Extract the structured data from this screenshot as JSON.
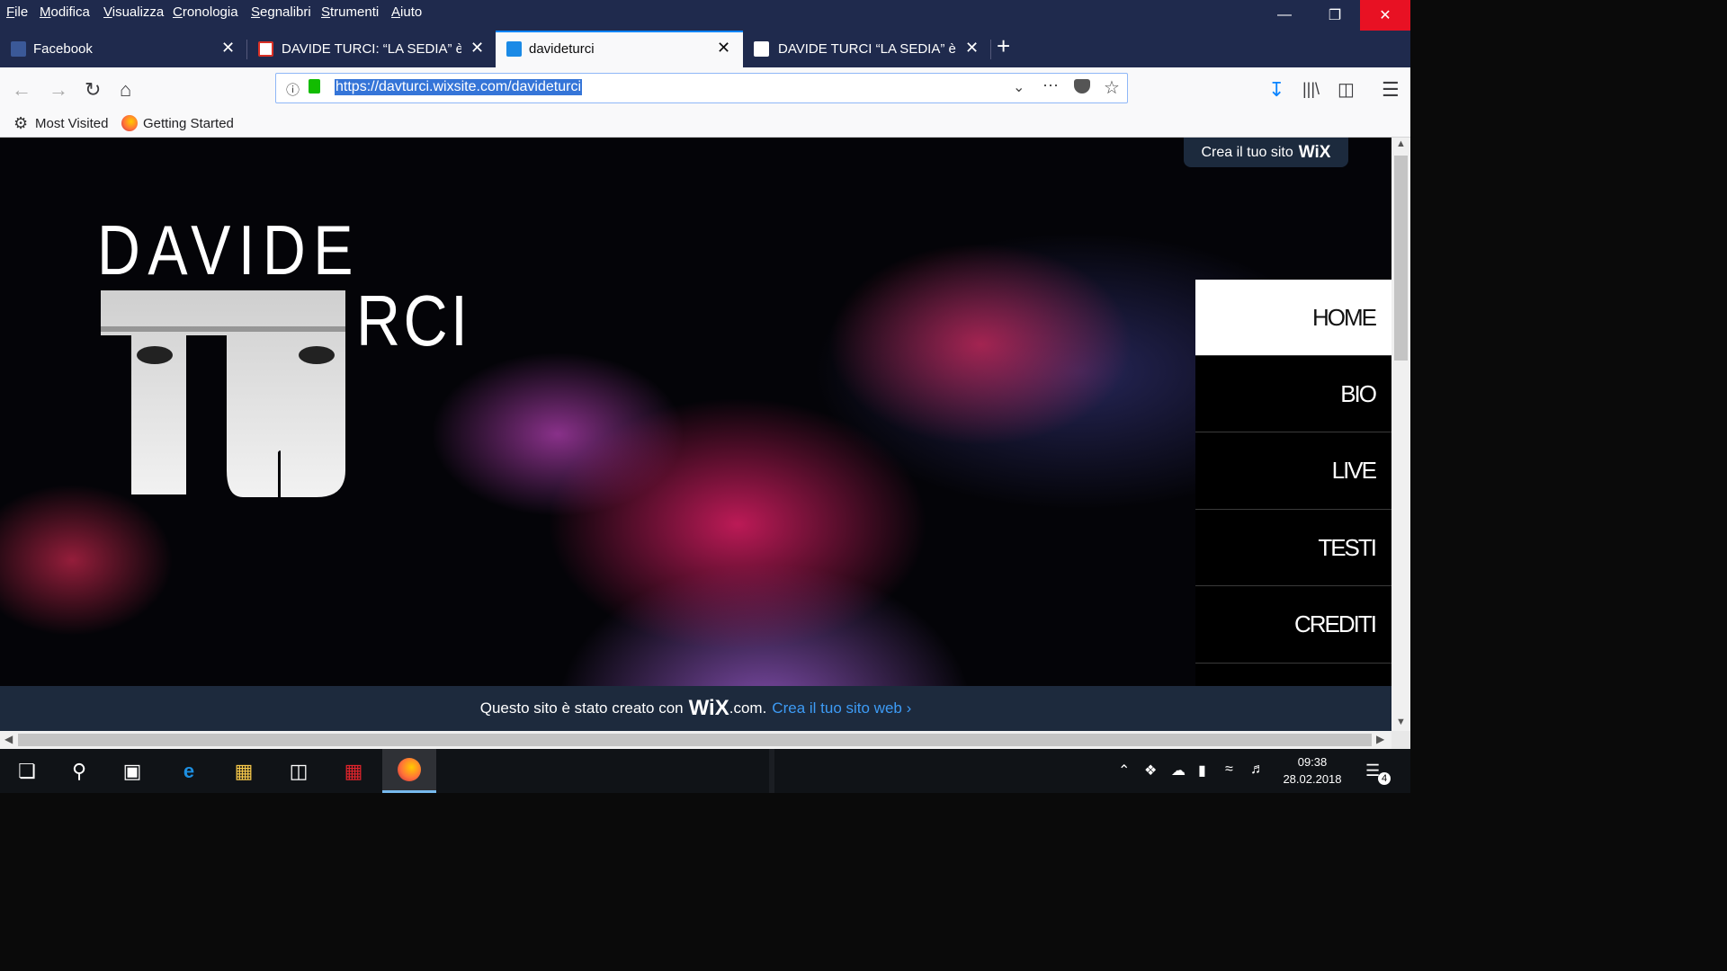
{
  "menubar": {
    "items": [
      "File",
      "Modifica",
      "Visualizza",
      "Cronologia",
      "Segnalibri",
      "Strumenti",
      "Aiuto"
    ]
  },
  "tabs": [
    {
      "title": "Facebook",
      "icon": "facebook-icon"
    },
    {
      "title": "DAVIDE TURCI: “LA SEDIA” è il p",
      "icon": "gmail-icon"
    },
    {
      "title": "davideturci",
      "icon": "wix-icon"
    },
    {
      "title": "DAVIDE TURCI “LA SEDIA” è il p",
      "icon": "site-icon"
    }
  ],
  "navbar": {
    "url": "https://davturci.wixsite.com/davideturci"
  },
  "bookmarks": [
    {
      "label": "Most Visited",
      "icon": "gear-icon"
    },
    {
      "label": "Getting Started",
      "icon": "firefox-icon"
    }
  ],
  "page": {
    "badge": {
      "text": "Crea il tuo sito",
      "brand": "WiX"
    },
    "logo": {
      "line1": "DAVIDE",
      "line2_rest": "RCI"
    },
    "nav": [
      "HOME",
      "BIO",
      "LIVE",
      "TESTI",
      "CREDITI"
    ],
    "footer": {
      "text": "Questo sito è stato creato con",
      "brand": "WiX",
      "domain": ".com.",
      "link": "Crea il tuo sito web ›"
    }
  },
  "taskbar": {
    "time": "09:38",
    "date": "28.02.2018",
    "notifications": "4"
  },
  "colors": {
    "chrome": "#1f2a4d",
    "accent": "#0a84ff",
    "wix_link": "#3d9bf5"
  }
}
